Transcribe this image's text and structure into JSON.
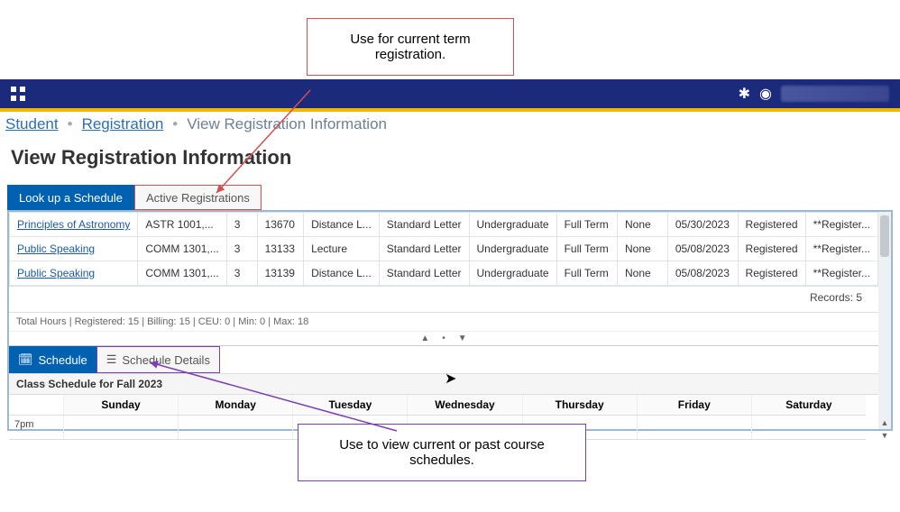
{
  "breadcrumb": {
    "a": "Student",
    "b": "Registration",
    "c": "View Registration Information"
  },
  "page_title": "View Registration Information",
  "tabs": {
    "lookup": "Look up a Schedule",
    "active": "Active Registrations"
  },
  "rows": [
    {
      "course": "Principles of Astronomy",
      "code": "ASTR 1001,...",
      "cred": "3",
      "crn": "13670",
      "mode": "Distance L...",
      "grade": "Standard Letter",
      "level": "Undergraduate",
      "part": "Full Term",
      "opt": "None",
      "date": "05/30/2023",
      "status": "Registered",
      "msg": "**Register..."
    },
    {
      "course": "Public Speaking",
      "code": "COMM 1301,...",
      "cred": "3",
      "crn": "13133",
      "mode": "Lecture",
      "grade": "Standard Letter",
      "level": "Undergraduate",
      "part": "Full Term",
      "opt": "None",
      "date": "05/08/2023",
      "status": "Registered",
      "msg": "**Register..."
    },
    {
      "course": "Public Speaking",
      "code": "COMM 1301,...",
      "cred": "3",
      "crn": "13139",
      "mode": "Distance L...",
      "grade": "Standard Letter",
      "level": "Undergraduate",
      "part": "Full Term",
      "opt": "None",
      "date": "05/08/2023",
      "status": "Registered",
      "msg": "**Register..."
    }
  ],
  "records_label": "Records: 5",
  "summary_line": "Total Hours | Registered: 15 | Billing: 15 | CEU: 0 | Min: 0 | Max: 18",
  "subtabs": {
    "schedule": "Schedule",
    "details": "Schedule Details"
  },
  "sched_title": "Class Schedule for Fall 2023",
  "days": {
    "sun": "Sunday",
    "mon": "Monday",
    "tue": "Tuesday",
    "wed": "Wednesday",
    "thu": "Thursday",
    "fri": "Friday",
    "sat": "Saturday"
  },
  "timeslot": "7pm",
  "callouts": {
    "top": "Use for current term registration.",
    "bottom": "Use to view current or past course schedules."
  }
}
